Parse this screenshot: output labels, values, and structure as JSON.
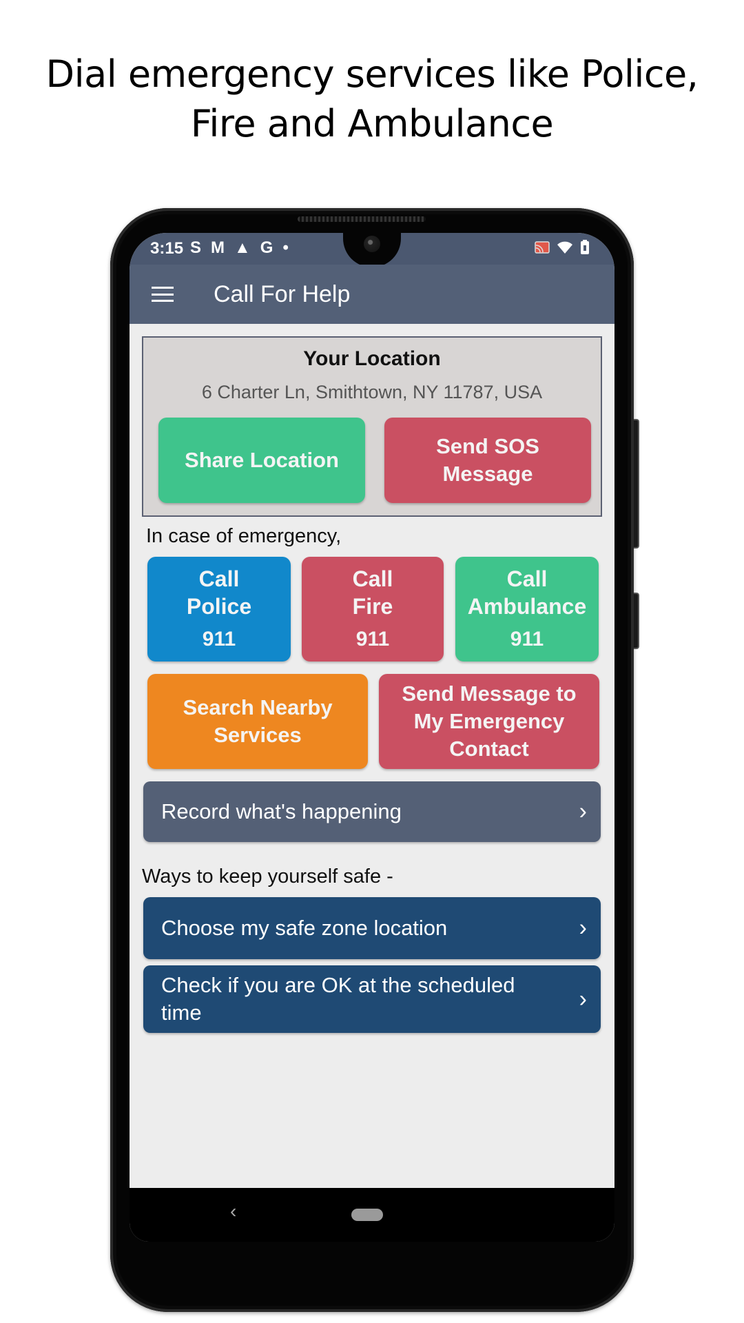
{
  "promo": {
    "title_line1": "Dial emergency services like Police,",
    "title_line2": "Fire and Ambulance"
  },
  "statusbar": {
    "time": "3:15",
    "left_icons": [
      "s-icon",
      "mail-icon",
      "warning-icon",
      "google-icon",
      "dot-icon"
    ],
    "left_glyphs": [
      "S",
      "M",
      "▲",
      "G",
      "•"
    ],
    "right_icons": [
      "cast-icon",
      "wifi-icon",
      "battery-icon"
    ]
  },
  "appbar": {
    "menu_icon": "hamburger-menu-icon",
    "title": "Call For Help",
    "color": "#536077"
  },
  "location": {
    "title": "Your Location",
    "address": "6 Charter Ln, Smithtown, NY 11787, USA",
    "share_button": "Share Location",
    "sos_button_line1": "Send SOS",
    "sos_button_line2": "Message"
  },
  "emergency": {
    "label": "In case of emergency,",
    "police": {
      "line1": "Call",
      "line2": "Police",
      "number": "911",
      "color": "#1188cb"
    },
    "fire": {
      "line1": "Call",
      "line2": "Fire",
      "number": "911",
      "color": "#ca5062"
    },
    "ambulance": {
      "line1": "Call",
      "line2": "Ambulance",
      "number": "911",
      "color": "#3fc48c"
    },
    "nearby": {
      "line1": "Search Nearby",
      "line2": "Services",
      "color": "#ee8720"
    },
    "contact": {
      "line1": "Send Message to",
      "line2": "My Emergency",
      "line3": "Contact",
      "color": "#ca5062"
    }
  },
  "record": {
    "label": "Record what's happening",
    "chevron": "›"
  },
  "safety": {
    "label": "Ways to keep yourself safe -",
    "items": [
      {
        "label": "Choose my safe zone location",
        "chevron": "›"
      },
      {
        "label": "Check if you are OK at the scheduled time",
        "chevron": "›"
      }
    ]
  },
  "navbar": {
    "back_glyph": "‹"
  }
}
